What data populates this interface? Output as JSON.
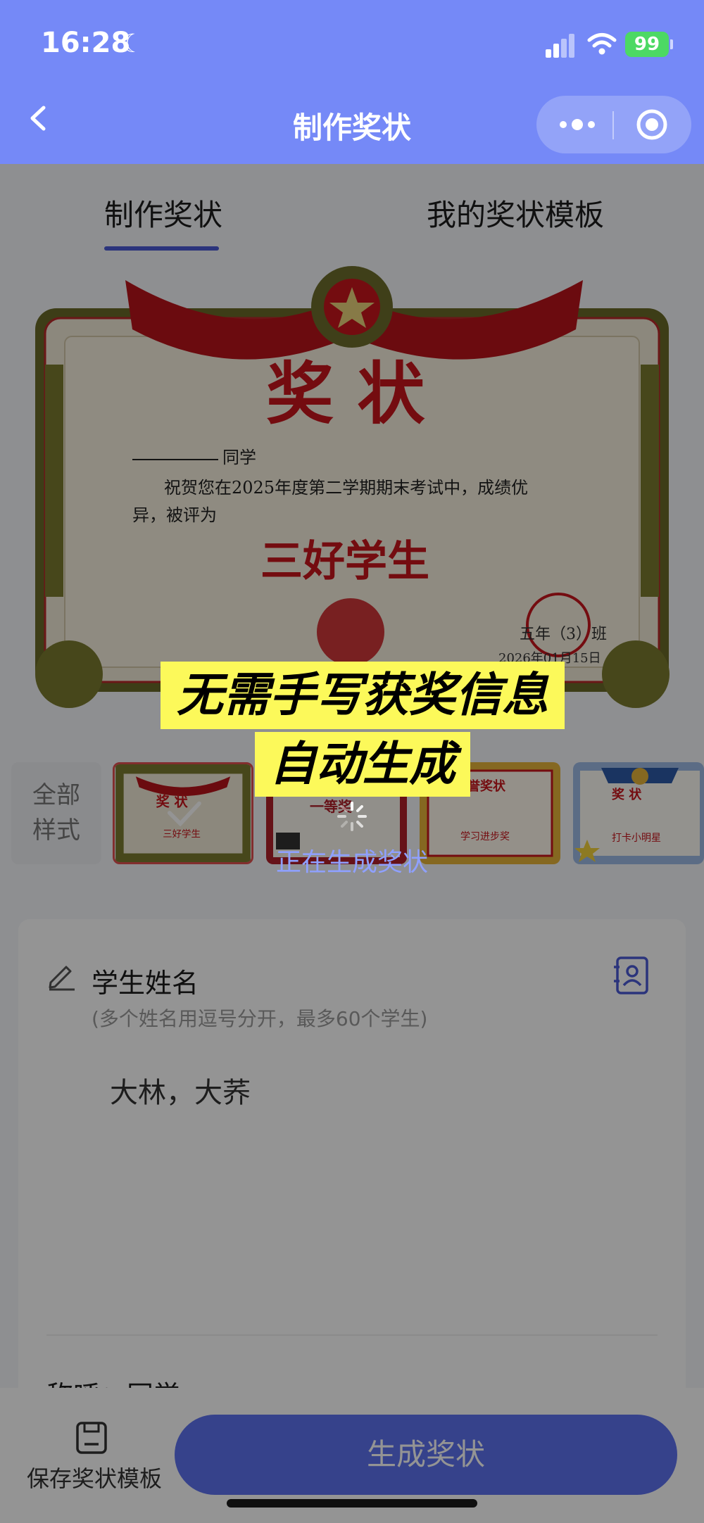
{
  "status": {
    "time": "16:28",
    "battery": "99"
  },
  "nav": {
    "title": "制作奖状"
  },
  "tabs": [
    {
      "label": "制作奖状"
    },
    {
      "label": "我的奖状模板"
    }
  ],
  "certificate": {
    "heading": "奖  状",
    "recipient_suffix": "同学",
    "body_line1": "祝贺您在2025年度第二学期期末考试中，成绩优",
    "body_line2": "异，被评为",
    "award": "三好学生",
    "seal_text": "五年（3）班",
    "date": "2026年01月15日"
  },
  "templates": {
    "all_label_line1": "全部",
    "all_label_line2": "样式",
    "items": [
      {
        "title": "奖  状",
        "award": "三好学生"
      },
      {
        "title": "",
        "award": "一等奖"
      },
      {
        "title": "荣誉奖状",
        "award": "学习进步奖"
      },
      {
        "title": "奖 状",
        "award": "打卡小明星"
      }
    ]
  },
  "form": {
    "name_label": "学生姓名",
    "name_hint": "(多个姓名用逗号分开，最多60个学生)",
    "name_value": "大林，大荞",
    "next_label": "称呼：同学"
  },
  "bottom": {
    "save_label": "保存奖状模板",
    "generate_label": "生成奖状"
  },
  "overlay": {
    "banner_line1": "无需手写获奖信息",
    "banner_line2": "自动生成",
    "loading_text": "正在生成奖状"
  },
  "colors": {
    "nav": "#7589f7",
    "accent": "#4a5bd6",
    "button": "#5d72f0",
    "highlight": "#fcf95a",
    "cert_red": "#c8161d"
  }
}
